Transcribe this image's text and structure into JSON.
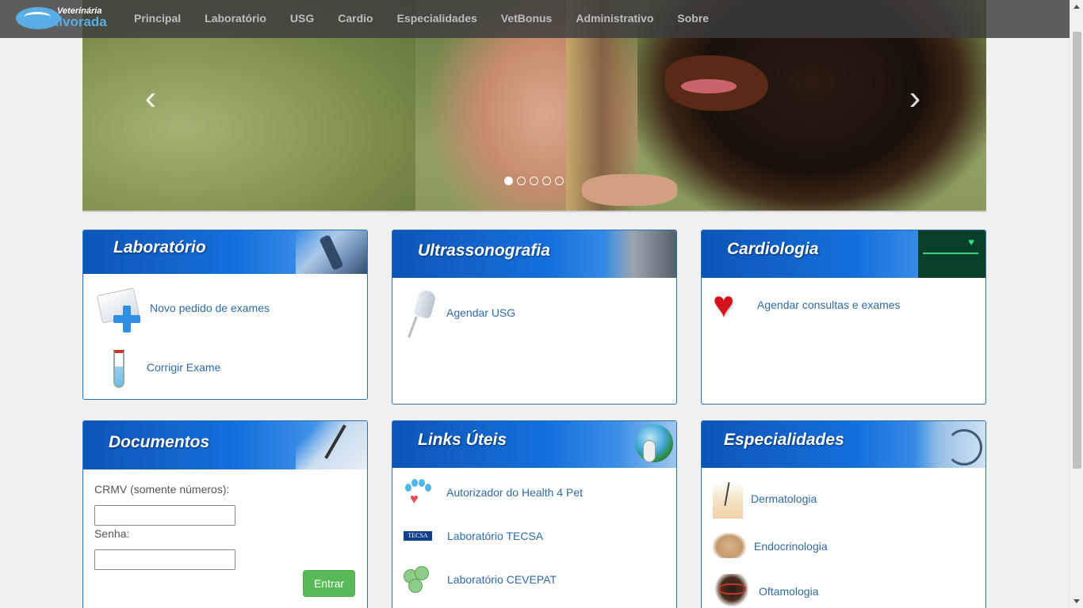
{
  "brand": {
    "line1": "Veterinária",
    "line2": "Alvorada"
  },
  "nav": {
    "items": [
      {
        "label": "Principal"
      },
      {
        "label": "Laboratório"
      },
      {
        "label": "USG"
      },
      {
        "label": "Cardio"
      },
      {
        "label": "Especialidades"
      },
      {
        "label": "VetBonus"
      },
      {
        "label": "Administrativo"
      },
      {
        "label": "Sobre"
      }
    ]
  },
  "carousel": {
    "prev": "‹",
    "next": "›",
    "slides": 5,
    "active_slide": 1
  },
  "panels": {
    "laboratorio": {
      "title": "Laboratório",
      "links": [
        {
          "label": "Novo pedido de exames"
        },
        {
          "label": "Corrigir Exame"
        }
      ]
    },
    "usg": {
      "title": "Ultrassonografia",
      "links": [
        {
          "label": "Agendar USG"
        }
      ]
    },
    "cardio": {
      "title": "Cardiologia",
      "links": [
        {
          "label": "Agendar consultas e exames"
        }
      ]
    },
    "documentos": {
      "title": "Documentos",
      "crmv_label": "CRMV (somente números):",
      "crmv_value": "",
      "senha_label": "Senha:",
      "senha_value": "",
      "submit_label": "Entrar"
    },
    "links_uteis": {
      "title": "Links Úteis",
      "links": [
        {
          "label": "Autorizador do Health 4 Pet"
        },
        {
          "label": "Laboratório TECSA"
        },
        {
          "label": "Laboratório CEVEPAT"
        }
      ],
      "tecsa_logo": "TECSA"
    },
    "especialidades": {
      "title": "Especialidades",
      "links": [
        {
          "label": "Dermatologia"
        },
        {
          "label": "Endocrinologia"
        },
        {
          "label": "Oftamologia"
        }
      ]
    }
  },
  "colors": {
    "panel_blue": "#1570dc",
    "link": "#2f6aa3",
    "button_green": "#58b957",
    "heart_red": "#d4141a"
  },
  "icons": [
    "doc-plus-icon",
    "test-tube-icon",
    "ultrasound-probe-icon",
    "heart-icon",
    "paw-icon",
    "tecsa-logo-icon",
    "cevepat-logo-icon",
    "dermatology-icon",
    "endocrinology-icon",
    "ophthalmology-icon"
  ]
}
